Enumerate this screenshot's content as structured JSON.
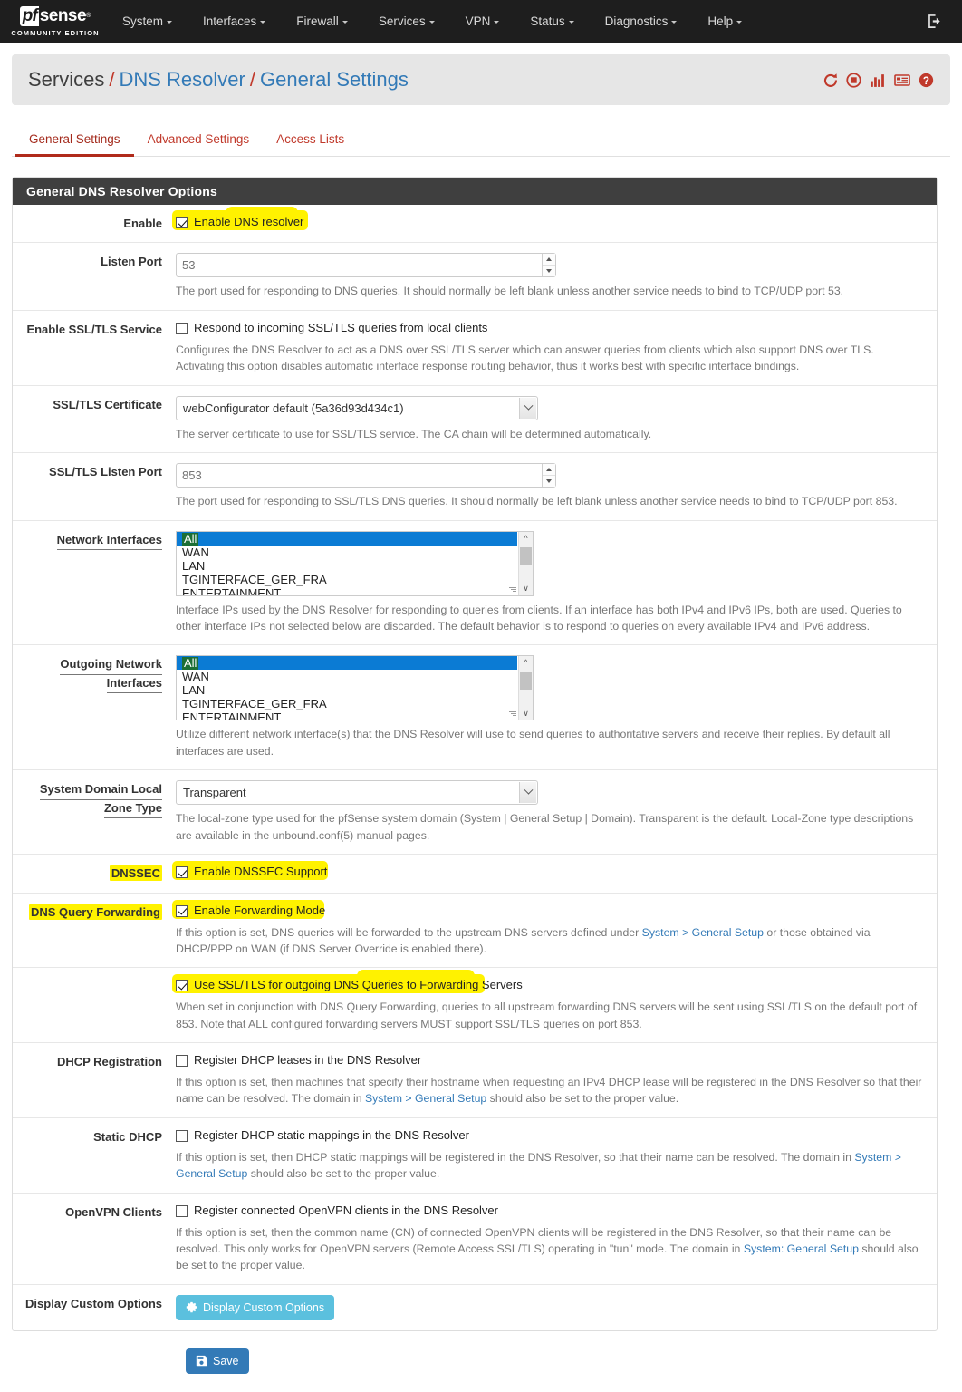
{
  "navbar": {
    "brand": {
      "pf": "pf",
      "sense": "sense",
      "subtitle": "COMMUNITY EDITION"
    },
    "items": [
      {
        "label": "System"
      },
      {
        "label": "Interfaces"
      },
      {
        "label": "Firewall"
      },
      {
        "label": "Services"
      },
      {
        "label": "VPN"
      },
      {
        "label": "Status"
      },
      {
        "label": "Diagnostics"
      },
      {
        "label": "Help"
      }
    ],
    "logout_icon": "logout-icon"
  },
  "breadcrumb": {
    "part1": "Services",
    "sep1": "/",
    "part2": "DNS Resolver",
    "sep2": "/",
    "part3": "General Settings",
    "icons": [
      {
        "name": "restart-service-icon",
        "glyph": "restart"
      },
      {
        "name": "stop-service-icon",
        "glyph": "stop"
      },
      {
        "name": "status-chart-icon",
        "glyph": "chart"
      },
      {
        "name": "log-icon",
        "glyph": "log"
      },
      {
        "name": "help-icon",
        "glyph": "help"
      }
    ]
  },
  "tabs": [
    {
      "label": "General Settings",
      "active": true
    },
    {
      "label": "Advanced Settings",
      "active": false
    },
    {
      "label": "Access Lists",
      "active": false
    }
  ],
  "panel": {
    "heading": "General DNS Resolver Options"
  },
  "fields": {
    "enable": {
      "label": "Enable",
      "checkbox_label": "Enable DNS resolver",
      "checked": true,
      "highlighted": true
    },
    "listen_port": {
      "label": "Listen Port",
      "placeholder": "53",
      "value": "",
      "help": "The port used for responding to DNS queries. It should normally be left blank unless another service needs to bind to TCP/UDP port 53."
    },
    "enable_ssl_tls_service": {
      "label": "Enable SSL/TLS Service",
      "checkbox_label": "Respond to incoming SSL/TLS queries from local clients",
      "checked": false,
      "help": "Configures the DNS Resolver to act as a DNS over SSL/TLS server which can answer queries from clients which also support DNS over TLS. Activating this option disables automatic interface response routing behavior, thus it works best with specific interface bindings."
    },
    "ssl_tls_certificate": {
      "label": "SSL/TLS Certificate",
      "selected": "webConfigurator default (5a36d93d434c1)",
      "help": "The server certificate to use for SSL/TLS service. The CA chain will be determined automatically."
    },
    "ssl_tls_listen_port": {
      "label": "SSL/TLS Listen Port",
      "placeholder": "853",
      "value": "",
      "help": "The port used for responding to SSL/TLS DNS queries. It should normally be left blank unless another service needs to bind to TCP/UDP port 853."
    },
    "network_interfaces": {
      "label": "Network Interfaces",
      "options": [
        "All",
        "WAN",
        "LAN",
        "TGINTERFACE_GER_FRA",
        "ENTERTAINMENT"
      ],
      "selected": "All",
      "highlighted": true,
      "help": "Interface IPs used by the DNS Resolver for responding to queries from clients. If an interface has both IPv4 and IPv6 IPs, both are used. Queries to other interface IPs not selected below are discarded. The default behavior is to respond to queries on every available IPv4 and IPv6 address."
    },
    "outgoing_network_interfaces": {
      "label_line1": "Outgoing Network",
      "label_line2": "Interfaces",
      "options": [
        "All",
        "WAN",
        "LAN",
        "TGINTERFACE_GER_FRA",
        "ENTERTAINMENT"
      ],
      "selected": "All",
      "highlighted": true,
      "help": "Utilize different network interface(s) that the DNS Resolver will use to send queries to authoritative servers and receive their replies. By default all interfaces are used."
    },
    "system_domain_local_zone_type": {
      "label_line1": "System Domain Local",
      "label_line2": "Zone Type",
      "selected": "Transparent",
      "help": "The local-zone type used for the pfSense system domain (System | General Setup | Domain). Transparent is the default. Local-Zone type descriptions are available in the unbound.conf(5) manual pages."
    },
    "dnssec": {
      "label": "DNSSEC",
      "checkbox_label": "Enable DNSSEC Support",
      "checked": true,
      "highlighted": true
    },
    "dns_query_forwarding": {
      "label": "DNS Query Forwarding",
      "checkbox_label": "Enable Forwarding Mode",
      "checked": true,
      "highlighted": true,
      "help_pre": "If this option is set, DNS queries will be forwarded to the upstream DNS servers defined under ",
      "help_link": "System > General Setup",
      "help_post": " or those obtained via DHCP/PPP on WAN (if DNS Server Override is enabled there)."
    },
    "use_ssl_tls_forwarding": {
      "checkbox_label": "Use SSL/TLS for outgoing DNS Queries to Forwarding Servers",
      "checked": true,
      "highlighted": true,
      "help": "When set in conjunction with DNS Query Forwarding, queries to all upstream forwarding DNS servers will be sent using SSL/TLS on the default port of 853. Note that ALL configured forwarding servers MUST support SSL/TLS queries on port 853."
    },
    "dhcp_registration": {
      "label": "DHCP Registration",
      "checkbox_label": "Register DHCP leases in the DNS Resolver",
      "checked": false,
      "help_pre": "If this option is set, then machines that specify their hostname when requesting an IPv4 DHCP lease will be registered in the DNS Resolver so that their name can be resolved. The domain in ",
      "help_link": "System > General Setup",
      "help_post": " should also be set to the proper value."
    },
    "static_dhcp": {
      "label": "Static DHCP",
      "checkbox_label": "Register DHCP static mappings in the DNS Resolver",
      "checked": false,
      "help_pre": "If this option is set, then DHCP static mappings will be registered in the DNS Resolver, so that their name can be resolved. The domain in ",
      "help_link": "System > General Setup",
      "help_post": " should also be set to the proper value."
    },
    "openvpn_clients": {
      "label": "OpenVPN Clients",
      "checkbox_label": "Register connected OpenVPN clients in the DNS Resolver",
      "checked": false,
      "help_pre": "If this option is set, then the common name (CN) of connected OpenVPN clients will be registered in the DNS Resolver, so that their name can be resolved. This only works for OpenVPN servers (Remote Access SSL/TLS) operating in \"tun\" mode. The domain in ",
      "help_link": "System: General Setup",
      "help_post": " should also be set to the proper value."
    },
    "display_custom_options": {
      "label": "Display Custom Options",
      "button_label": "Display Custom Options",
      "button_icon": "gear-icon"
    }
  },
  "save": {
    "label": "Save",
    "icon": "save-icon"
  },
  "colors": {
    "navbar_bg": "#1e1e1e",
    "panel_heading_bg": "#3f3f3f",
    "accent_red": "#c0392b",
    "link_blue": "#337ab7",
    "highlight_yellow": "#fff200",
    "select_blue": "#0b7bd4",
    "btn_info": "#5bc0de",
    "btn_primary": "#337ab7"
  }
}
